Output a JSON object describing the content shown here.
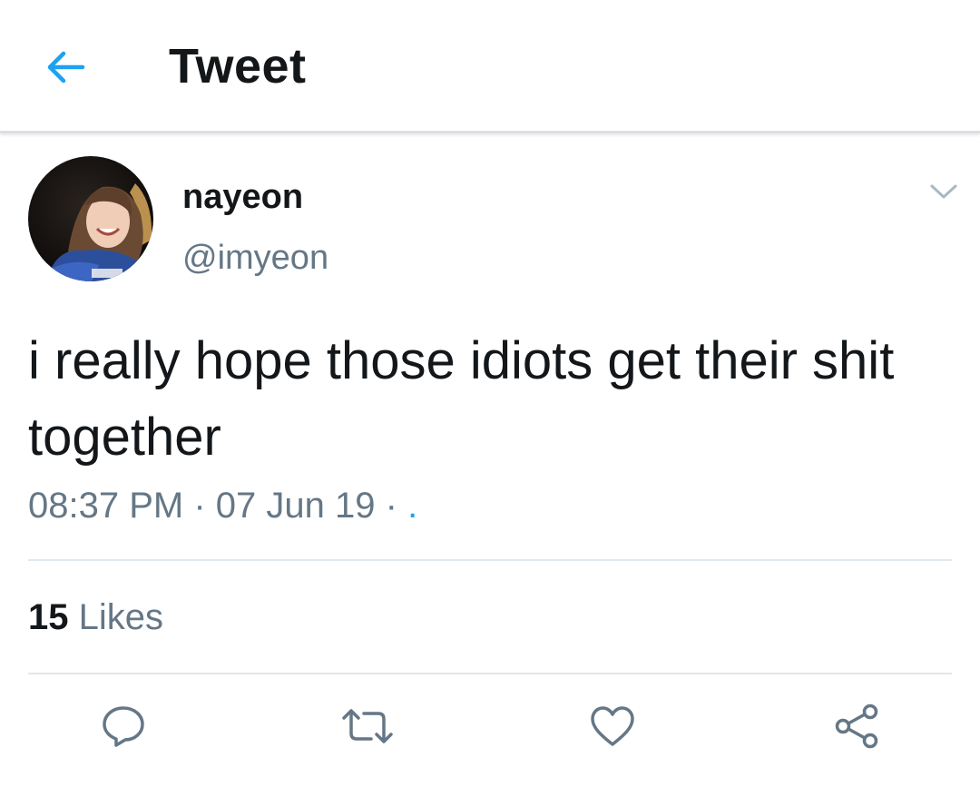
{
  "header": {
    "title": "Tweet",
    "back_icon": "arrow-left-icon",
    "accent_color": "#1da1f2"
  },
  "tweet": {
    "author": {
      "display_name": "nayeon",
      "handle": "@imyeon"
    },
    "text": "i really hope those idiots get their shit together",
    "time": "08:37 PM",
    "date": "07 Jun 19",
    "source": ".",
    "separator": "·",
    "likes": {
      "count": "15",
      "label": "Likes"
    }
  },
  "actions": [
    {
      "name": "reply",
      "icon": "reply-icon"
    },
    {
      "name": "retweet",
      "icon": "retweet-icon"
    },
    {
      "name": "like",
      "icon": "heart-icon"
    },
    {
      "name": "share",
      "icon": "share-icon"
    }
  ],
  "colors": {
    "text_primary": "#14171a",
    "text_secondary": "#657786",
    "divider": "#e1e8ed",
    "icon_gray": "#657786"
  }
}
